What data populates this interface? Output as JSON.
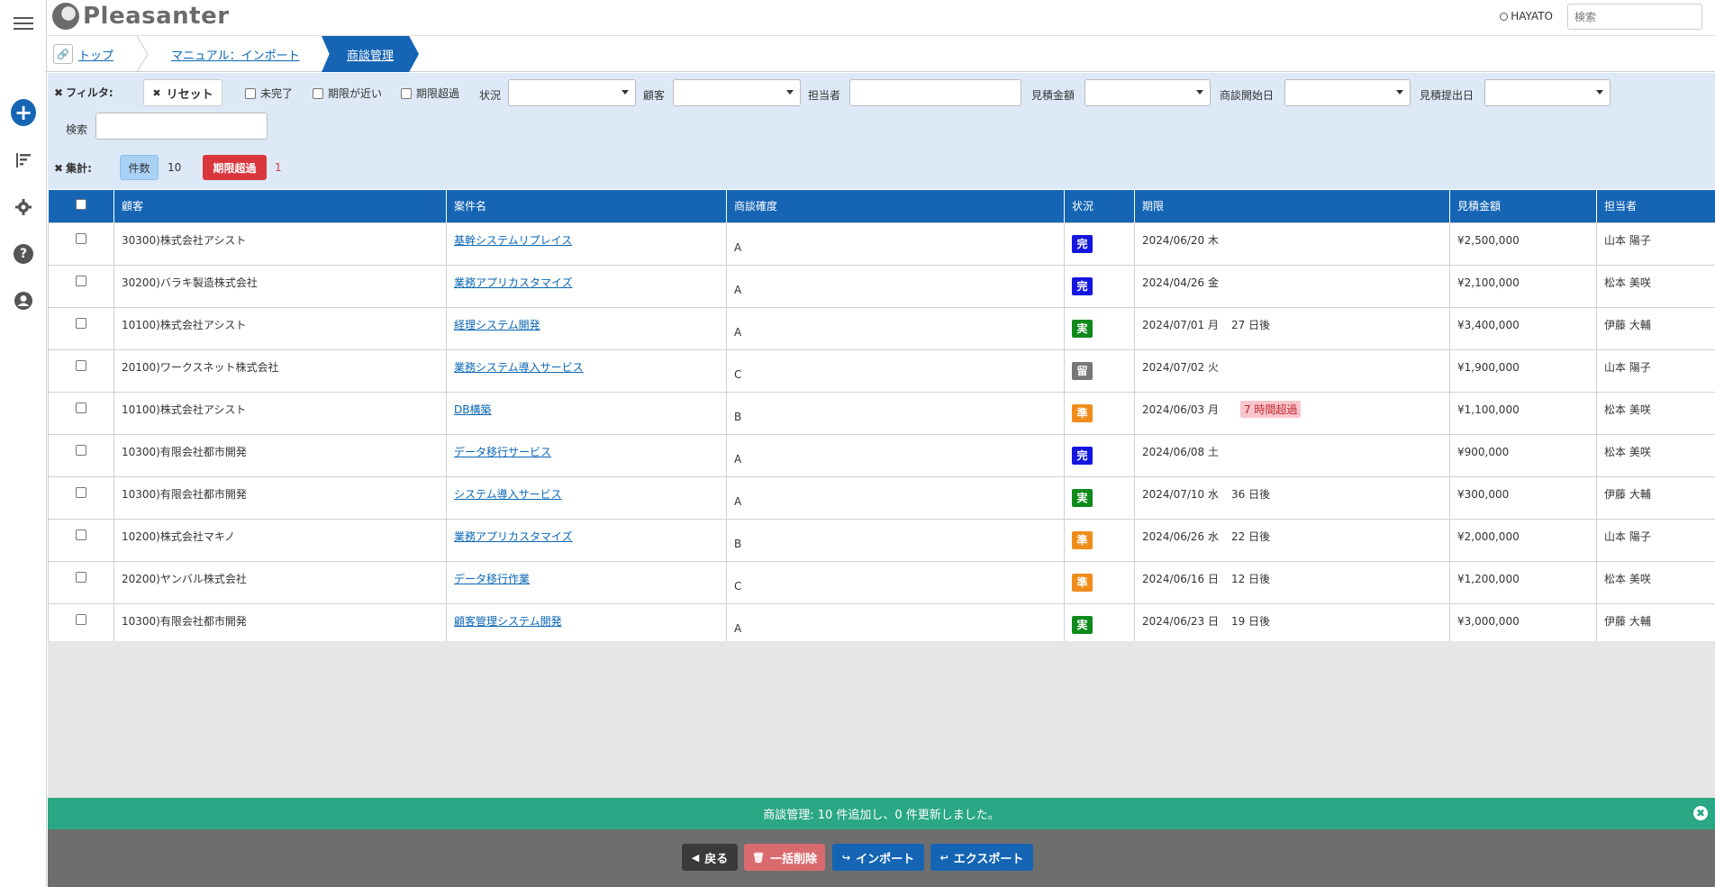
{
  "app": {
    "name": "Pleasanter"
  },
  "header": {
    "user": "HAYATO",
    "search_placeholder": "検索"
  },
  "breadcrumb": {
    "items": [
      "トップ",
      "マニュアル：インポート"
    ],
    "current": "商談管理"
  },
  "filters": {
    "filter_label": "フィルタ:",
    "reset_label": "リセット",
    "checkboxes": [
      "未完了",
      "期限が近い",
      "期限超過"
    ],
    "status_label": "状況",
    "customer_label": "顧客",
    "owner_label": "担当者",
    "amount_label": "見積金額",
    "start_label": "商談開始日",
    "submit_label": "見積提出日",
    "search_label": "検索",
    "summary_label": "集計:",
    "count_label": "件数",
    "count_value": "10",
    "overdue_label": "期限超過",
    "overdue_value": "1"
  },
  "table": {
    "headers": [
      "顧客",
      "案件名",
      "商談確度",
      "状況",
      "期限",
      "見積金額",
      "担当者"
    ],
    "rows": [
      {
        "customer": "30300)株式会社アシスト",
        "title": "基幹システムリプレイス",
        "rank": "A",
        "status": "完",
        "status_color": "#1416e0",
        "due": "2024/06/20 木",
        "due_note": "",
        "overdue": "",
        "amount": "¥2,500,000",
        "owner": "山本 陽子"
      },
      {
        "customer": "30200)バラキ製造株式会社",
        "title": "業務アプリカスタマイズ",
        "rank": "A",
        "status": "完",
        "status_color": "#1416e0",
        "due": "2024/04/26 金",
        "due_note": "",
        "overdue": "",
        "amount": "¥2,100,000",
        "owner": "松本 美咲"
      },
      {
        "customer": "10100)株式会社アシスト",
        "title": "経理システム開発",
        "rank": "A",
        "status": "実",
        "status_color": "#0f8a1b",
        "due": "2024/07/01 月",
        "due_note": "27 日後",
        "overdue": "",
        "amount": "¥3,400,000",
        "owner": "伊藤 大輔"
      },
      {
        "customer": "20100)ワークスネット株式会社",
        "title": "業務システム導入サービス",
        "rank": "C",
        "status": "留",
        "status_color": "#777777",
        "due": "2024/07/02 火",
        "due_note": "",
        "overdue": "",
        "amount": "¥1,900,000",
        "owner": "山本 陽子"
      },
      {
        "customer": "10100)株式会社アシスト",
        "title": "DB構築",
        "rank": "B",
        "status": "準",
        "status_color": "#f08c1a",
        "due": "2024/06/03 月",
        "due_note": "",
        "overdue": "7 時間超過",
        "amount": "¥1,100,000",
        "owner": "松本 美咲"
      },
      {
        "customer": "10300)有限会社都市開発",
        "title": "データ移行サービス",
        "rank": "A",
        "status": "完",
        "status_color": "#1416e0",
        "due": "2024/06/08 土",
        "due_note": "",
        "overdue": "",
        "amount": "¥900,000",
        "owner": "松本 美咲"
      },
      {
        "customer": "10300)有限会社都市開発",
        "title": "システム導入サービス",
        "rank": "A",
        "status": "実",
        "status_color": "#0f8a1b",
        "due": "2024/07/10 水",
        "due_note": "36 日後",
        "overdue": "",
        "amount": "¥300,000",
        "owner": "伊藤 大輔"
      },
      {
        "customer": "10200)株式会社マキノ",
        "title": "業務アプリカスタマイズ",
        "rank": "B",
        "status": "準",
        "status_color": "#f08c1a",
        "due": "2024/06/26 水",
        "due_note": "22 日後",
        "overdue": "",
        "amount": "¥2,000,000",
        "owner": "山本 陽子"
      },
      {
        "customer": "20200)ヤンバル株式会社",
        "title": "データ移行作業",
        "rank": "C",
        "status": "準",
        "status_color": "#f08c1a",
        "due": "2024/06/16 日",
        "due_note": "12 日後",
        "overdue": "",
        "amount": "¥1,200,000",
        "owner": "松本 美咲"
      },
      {
        "customer": "10300)有限会社都市開発",
        "title": "顧客管理システム開発",
        "rank": "A",
        "status": "実",
        "status_color": "#0f8a1b",
        "due": "2024/06/23 日",
        "due_note": "19 日後",
        "overdue": "",
        "amount": "¥3,000,000",
        "owner": "伊藤 大輔"
      }
    ]
  },
  "message": "商談管理: 10 件追加し、0 件更新しました。",
  "footer": {
    "back": "戻る",
    "bulk_delete": "一括削除",
    "import": "インポート",
    "export": "エクスポート"
  }
}
